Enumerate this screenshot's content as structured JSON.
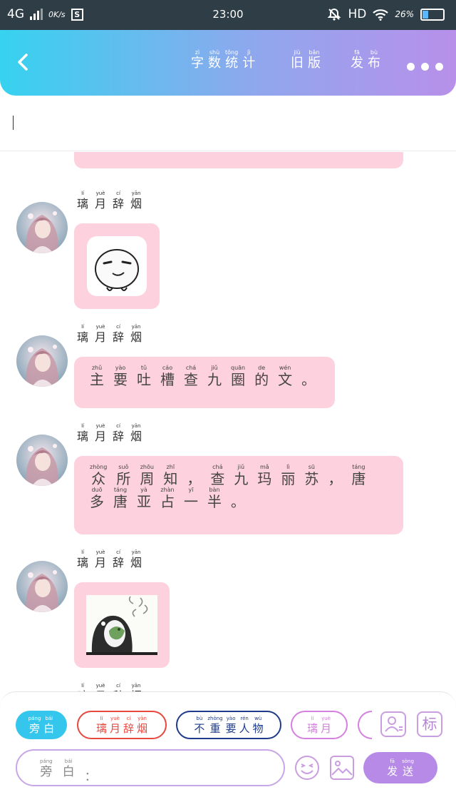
{
  "status_bar": {
    "network": "4G",
    "speed": "0K/s",
    "s_badge": "S",
    "time": "23:00",
    "hd": "HD",
    "battery_percent": "26%",
    "battery_level": 0.26
  },
  "header": {
    "nav_items": [
      {
        "id": "word-count",
        "chars": [
          [
            "zì",
            "字"
          ],
          [
            "shù",
            "数"
          ],
          [
            "tǒng",
            "统"
          ],
          [
            "jì",
            "计"
          ]
        ]
      },
      {
        "id": "old-version",
        "chars": [
          [
            "jiù",
            "旧"
          ],
          [
            "bǎn",
            "版"
          ]
        ]
      },
      {
        "id": "publish",
        "chars": [
          [
            "fā",
            "发"
          ],
          [
            "bù",
            "布"
          ]
        ]
      }
    ]
  },
  "title_input": {
    "value": ""
  },
  "messages": [
    {
      "sender": [
        [
          "lí",
          "璃"
        ],
        [
          "yuè",
          "月"
        ],
        [
          "cí",
          "辞"
        ],
        [
          "yān",
          "烟"
        ]
      ],
      "type": "sticker",
      "sticker": "smirk-face-sticker"
    },
    {
      "sender": [
        [
          "lí",
          "璃"
        ],
        [
          "yuè",
          "月"
        ],
        [
          "cí",
          "辞"
        ],
        [
          "yān",
          "烟"
        ]
      ],
      "type": "text",
      "lines": [
        [
          [
            "zhǔ",
            "主"
          ],
          [
            "yào",
            "要"
          ],
          [
            "tǔ",
            "吐"
          ],
          [
            "cáo",
            "槽"
          ],
          [
            "chá",
            "查"
          ],
          [
            "jiǔ",
            "九"
          ],
          [
            "quān",
            "圈"
          ],
          [
            "de",
            "的"
          ],
          [
            "wén",
            "文"
          ],
          [
            "",
            "。"
          ]
        ]
      ]
    },
    {
      "sender": [
        [
          "lí",
          "璃"
        ],
        [
          "yuè",
          "月"
        ],
        [
          "cí",
          "辞"
        ],
        [
          "yān",
          "烟"
        ]
      ],
      "type": "text",
      "lines": [
        [
          [
            "zhòng",
            "众"
          ],
          [
            "suǒ",
            "所"
          ],
          [
            "zhōu",
            "周"
          ],
          [
            "zhī",
            "知"
          ],
          [
            "",
            "，"
          ],
          [
            "chá",
            "查"
          ],
          [
            "jiǔ",
            "九"
          ],
          [
            "mǎ",
            "玛"
          ],
          [
            "lì",
            "丽"
          ],
          [
            "sū",
            "苏"
          ],
          [
            "",
            "，"
          ],
          [
            "táng",
            "唐"
          ]
        ],
        [
          [
            "duō",
            "多"
          ],
          [
            "táng",
            "唐"
          ],
          [
            "yà",
            "亚"
          ],
          [
            "zhàn",
            "占"
          ],
          [
            "yī",
            "一"
          ],
          [
            "bàn",
            "半"
          ],
          [
            "",
            "。"
          ]
        ]
      ]
    },
    {
      "sender": [
        [
          "lí",
          "璃"
        ],
        [
          "yuè",
          "月"
        ],
        [
          "cí",
          "辞"
        ],
        [
          "yān",
          "烟"
        ]
      ],
      "type": "sticker",
      "sticker": "penguin-sticker"
    },
    {
      "sender": [
        [
          "lí",
          "璃"
        ],
        [
          "yuè",
          "月"
        ],
        [
          "cí",
          "辞"
        ],
        [
          "yān",
          "烟"
        ]
      ],
      "type": "partial"
    }
  ],
  "toolbar": {
    "chips": [
      {
        "id": "narration",
        "chars": [
          [
            "páng",
            "旁"
          ],
          [
            "bái",
            "白"
          ]
        ],
        "style": "filled",
        "color": "#35c6ee"
      },
      {
        "id": "liyue-ciyan",
        "chars": [
          [
            "lí",
            "璃"
          ],
          [
            "yuè",
            "月"
          ],
          [
            "cí",
            "辞"
          ],
          [
            "yān",
            "烟"
          ]
        ],
        "style": "outline",
        "color": "#e8473e"
      },
      {
        "id": "unimportant",
        "chars": [
          [
            "bù",
            "不"
          ],
          [
            "zhòng",
            "重"
          ],
          [
            "yào",
            "要"
          ],
          [
            "rén",
            "人"
          ],
          [
            "wù",
            "物"
          ]
        ],
        "style": "outline",
        "color": "#1f3b8a"
      },
      {
        "id": "liyue",
        "chars": [
          [
            "lí",
            "璃"
          ],
          [
            "yuè",
            "月"
          ]
        ],
        "style": "outline",
        "color": "#d57fe0"
      }
    ],
    "label_button": "标",
    "input_placeholder": {
      "chars": [
        [
          "páng",
          "旁"
        ],
        [
          "bái",
          "白"
        ]
      ],
      "suffix": "："
    },
    "send_button": [
      [
        "fā",
        "发"
      ],
      [
        "sòng",
        "送"
      ]
    ]
  },
  "colors": {
    "status_bar_bg": "#2f3e46",
    "header_gradient": [
      "#36d2f0",
      "#8ea8ee",
      "#b890ea"
    ],
    "bubble_pink": "#fdd1dd",
    "send_purple": "#b68ae6"
  }
}
